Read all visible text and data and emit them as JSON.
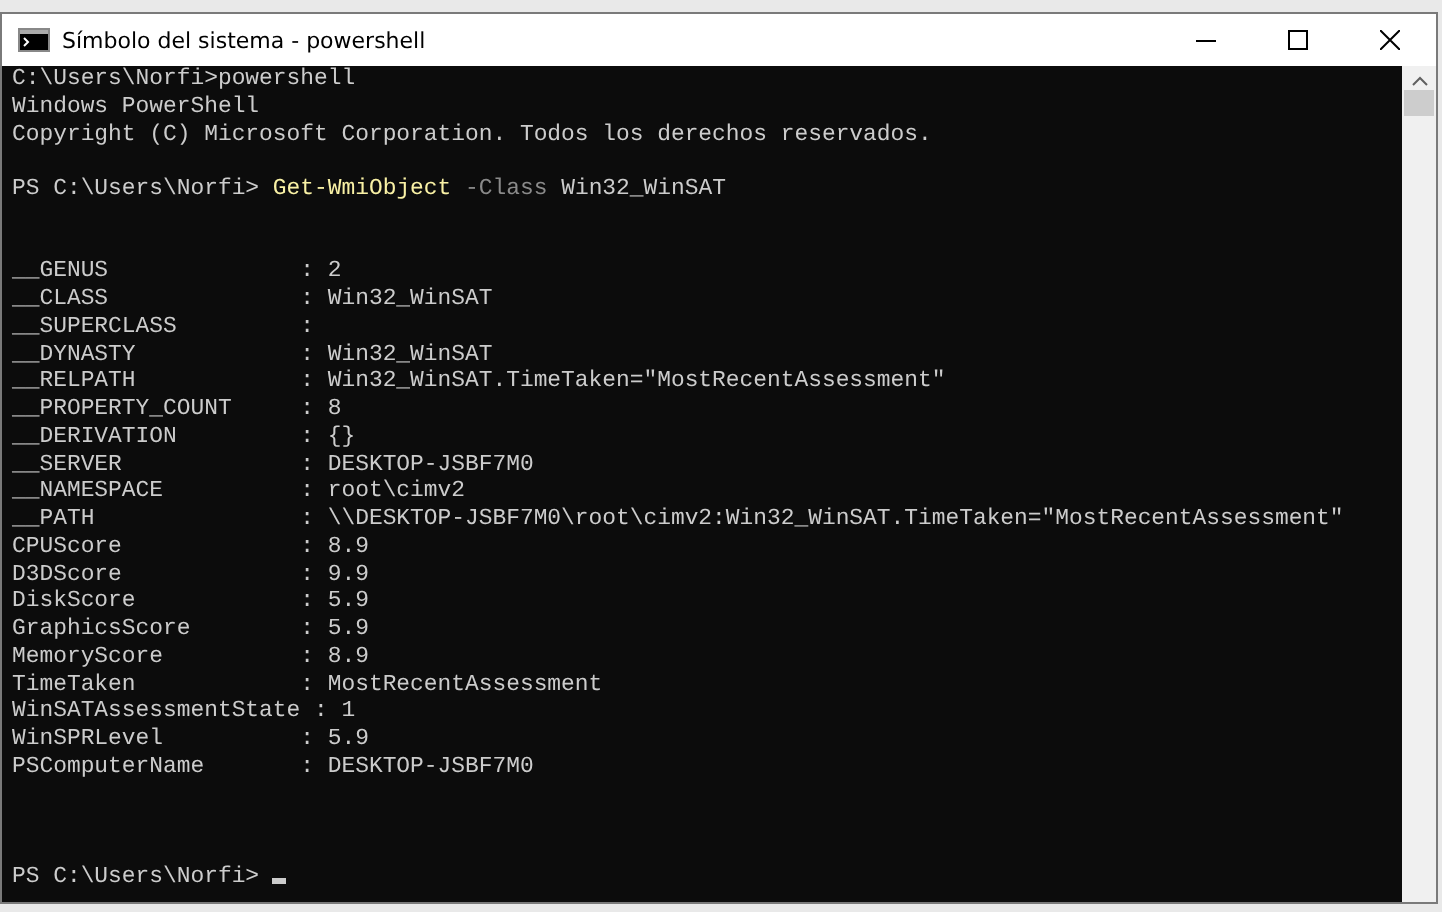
{
  "window": {
    "title": "Símbolo del sistema - powershell"
  },
  "console": {
    "lines": [
      {
        "kind": "plain",
        "text": "C:\\Users\\Norfi>powershell"
      },
      {
        "kind": "plain",
        "text": "Windows PowerShell"
      },
      {
        "kind": "plain",
        "text": "Copyright (C) Microsoft Corporation. Todos los derechos reservados."
      },
      {
        "kind": "blank"
      },
      {
        "kind": "command",
        "prompt": "PS C:\\Users\\Norfi>",
        "command": "Get-WmiObject",
        "parameter": "-Class",
        "argument": "Win32_WinSAT"
      },
      {
        "kind": "blank"
      },
      {
        "kind": "blank"
      },
      {
        "kind": "plain",
        "text": "__GENUS              : 2"
      },
      {
        "kind": "plain",
        "text": "__CLASS              : Win32_WinSAT"
      },
      {
        "kind": "plain",
        "text": "__SUPERCLASS         :"
      },
      {
        "kind": "plain",
        "text": "__DYNASTY            : Win32_WinSAT"
      },
      {
        "kind": "plain",
        "text": "__RELPATH            : Win32_WinSAT.TimeTaken=\"MostRecentAssessment\""
      },
      {
        "kind": "plain",
        "text": "__PROPERTY_COUNT     : 8"
      },
      {
        "kind": "plain",
        "text": "__DERIVATION         : {}"
      },
      {
        "kind": "plain",
        "text": "__SERVER             : DESKTOP-JSBF7M0"
      },
      {
        "kind": "plain",
        "text": "__NAMESPACE          : root\\cimv2"
      },
      {
        "kind": "plain",
        "text": "__PATH               : \\\\DESKTOP-JSBF7M0\\root\\cimv2:Win32_WinSAT.TimeTaken=\"MostRecentAssessment\""
      },
      {
        "kind": "plain",
        "text": "CPUScore             : 8.9"
      },
      {
        "kind": "plain",
        "text": "D3DScore             : 9.9"
      },
      {
        "kind": "plain",
        "text": "DiskScore            : 5.9"
      },
      {
        "kind": "plain",
        "text": "GraphicsScore        : 5.9"
      },
      {
        "kind": "plain",
        "text": "MemoryScore          : 8.9"
      },
      {
        "kind": "plain",
        "text": "TimeTaken            : MostRecentAssessment"
      },
      {
        "kind": "plain",
        "text": "WinSATAssessmentState : 1"
      },
      {
        "kind": "plain",
        "text": "WinSPRLevel          : 5.9"
      },
      {
        "kind": "plain",
        "text": "PSComputerName       : DESKTOP-JSBF7M0"
      },
      {
        "kind": "blank"
      },
      {
        "kind": "blank"
      },
      {
        "kind": "blank"
      },
      {
        "kind": "prompt",
        "prompt": "PS C:\\Users\\Norfi>",
        "cursor": true
      }
    ]
  }
}
